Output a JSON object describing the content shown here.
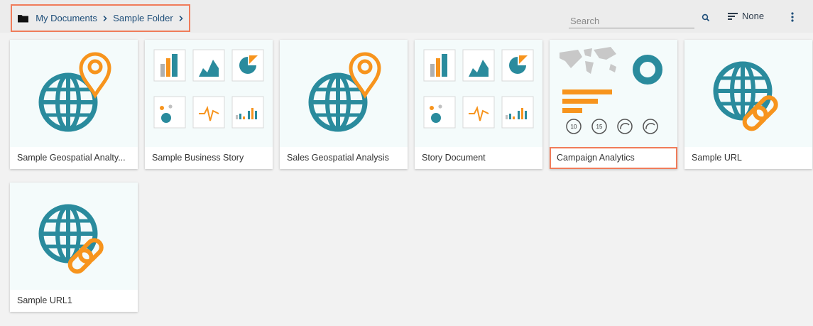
{
  "breadcrumb": {
    "items": [
      "My Documents",
      "Sample Folder"
    ]
  },
  "search": {
    "placeholder": "Search"
  },
  "sort": {
    "label": "None"
  },
  "icons": {
    "folder": "folder-icon",
    "chevron": "chevron-right-icon",
    "search": "search-icon",
    "sort": "sort-icon",
    "menu": "kebab-menu-icon"
  },
  "colors": {
    "accent": "#2a8b9d",
    "orange": "#f7941d",
    "highlight": "#f07c5a",
    "breadcrumb_text": "#1e4e79"
  },
  "documents": [
    {
      "label": "Sample Geospatial Analty...",
      "type": "geospatial"
    },
    {
      "label": "Sample Business Story",
      "type": "story"
    },
    {
      "label": "Sales Geospatial Analysis",
      "type": "geospatial"
    },
    {
      "label": "Story Document",
      "type": "story"
    },
    {
      "label": "Campaign Analytics",
      "type": "dashboard",
      "highlighted": true
    },
    {
      "label": "Sample URL",
      "type": "url"
    },
    {
      "label": "Sample URL1",
      "type": "url"
    }
  ]
}
